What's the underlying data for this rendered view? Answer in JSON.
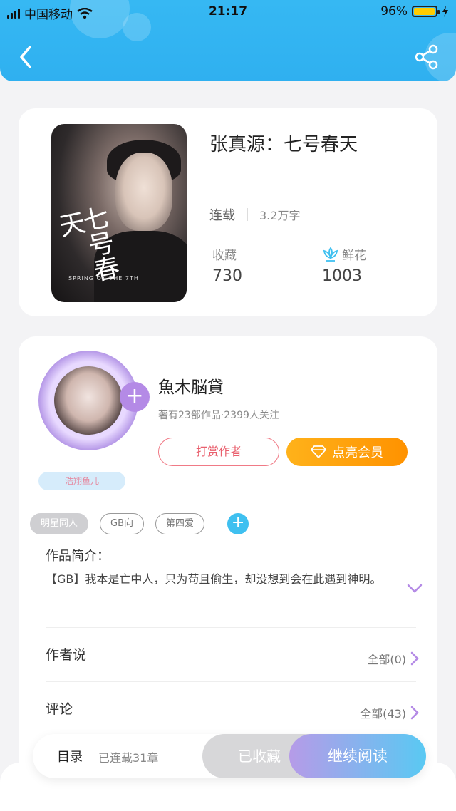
{
  "status_bar": {
    "carrier": "中国移动",
    "time": "21:17",
    "battery": "96%",
    "battery_level": 0.96
  },
  "book": {
    "title": "张真源：七号春天",
    "status": "连载",
    "word_count": "3.2万字",
    "favorites_label": "收藏",
    "favorites_value": "730",
    "flowers_label": "鲜花",
    "flowers_value": "1003",
    "cover_title": "七号春天",
    "cover_subtitle": "SPRING ON THE 7TH"
  },
  "author": {
    "name": "魚木脳貸",
    "stats": "著有23部作品·2399人关注",
    "badge": "浩翔鱼儿",
    "tip_label": "打赏作者",
    "vip_label": "点亮会员"
  },
  "tags": [
    "明星同人",
    "GB向",
    "第四爱"
  ],
  "intro": {
    "title": "作品简介：",
    "text": "【GB】我本是亡中人，只为苟且偷生，却没想到会在此遇到神明。"
  },
  "author_says": {
    "title": "作者说",
    "link": "全部(0)"
  },
  "comments": {
    "title": "评论",
    "link": "全部(43)"
  },
  "bottom_bar": {
    "toc_label": "目录",
    "toc_count": "已连载31章",
    "collected_label": "已收藏",
    "read_label": "继续阅读"
  },
  "colors": {
    "header": "#36b8f3",
    "vip": "#ff9f0d",
    "tip": "#e9606e",
    "accent_purple": "#b48ae6"
  }
}
